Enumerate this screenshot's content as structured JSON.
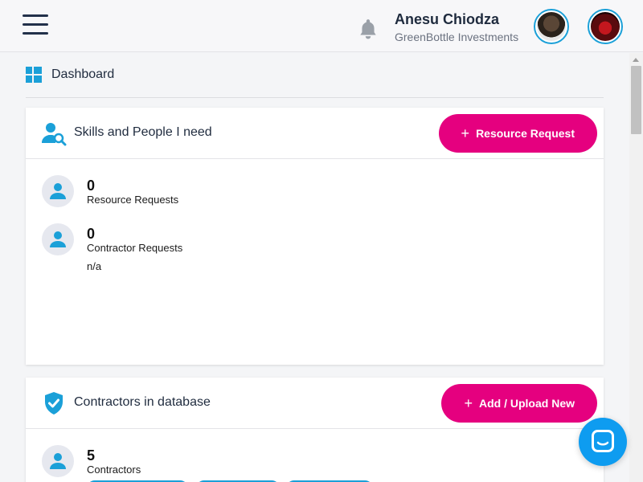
{
  "header": {
    "user_name": "Anesu Chiodza",
    "company": "GreenBottle Investments",
    "icons": [
      "menu-icon",
      "bell-icon",
      "user-avatar",
      "company-avatar"
    ]
  },
  "breadcrumb": {
    "label": "Dashboard",
    "icon": "dashboard-icon"
  },
  "skills_card": {
    "title": "Skills and People I need",
    "icon": "user-search-icon",
    "button_label": "Resource Request",
    "stats": [
      {
        "value": "0",
        "label": "Resource Requests"
      },
      {
        "value": "0",
        "label": "Contractor Requests"
      }
    ],
    "note": "n/a"
  },
  "contractors_card": {
    "title": "Contractors in database",
    "icon": "shield-check-icon",
    "button_label": "Add / Upload New",
    "stats": [
      {
        "value": "5",
        "label": "Contractors"
      }
    ]
  },
  "colors": {
    "accent": "#e5007f",
    "brand_blue": "#1ba0d8",
    "chat": "#0e9cf0"
  }
}
